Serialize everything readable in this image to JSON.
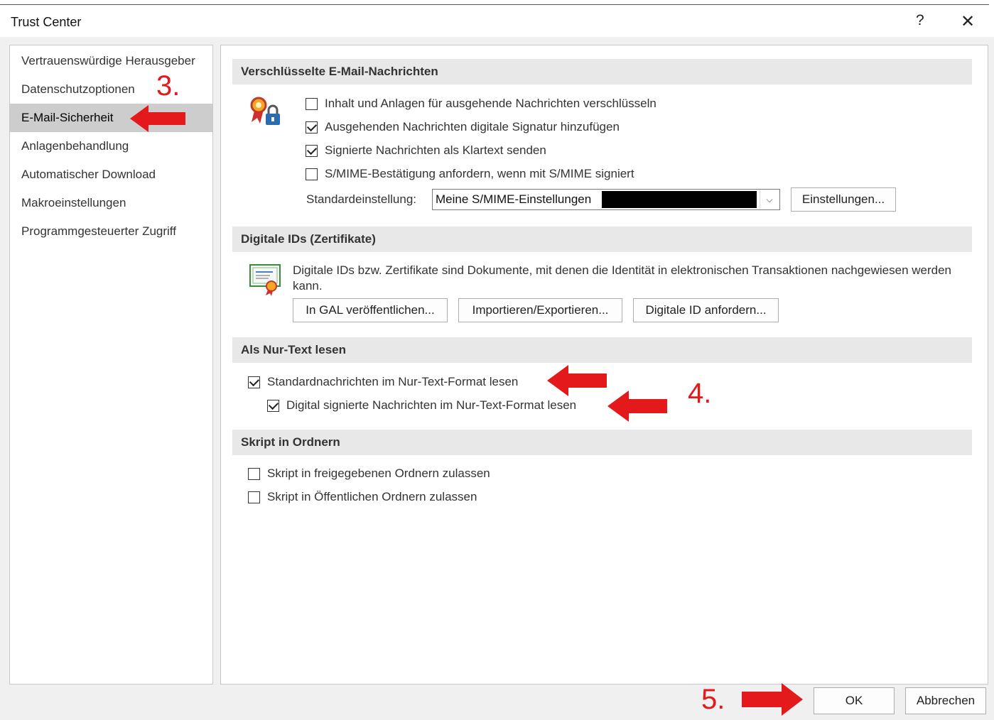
{
  "window": {
    "title": "Trust Center",
    "help_label": "?",
    "close_label": "✕"
  },
  "sidebar": {
    "items": [
      {
        "label": "Vertrauenswürdige Herausgeber"
      },
      {
        "label": "Datenschutzoptionen"
      },
      {
        "label": "E-Mail-Sicherheit",
        "active": true
      },
      {
        "label": "Anlagenbehandlung"
      },
      {
        "label": "Automatischer Download"
      },
      {
        "label": "Makroeinstellungen"
      },
      {
        "label": "Programmgesteuerter Zugriff"
      }
    ]
  },
  "sections": {
    "encrypted": {
      "heading": "Verschlüsselte E-Mail-Nachrichten",
      "icon": "certificate-lock-icon",
      "options": [
        {
          "label": "Inhalt und Anlagen für ausgehende Nachrichten verschlüsseln",
          "checked": false
        },
        {
          "label": "Ausgehenden Nachrichten digitale Signatur hinzufügen",
          "checked": true
        },
        {
          "label": "Signierte Nachrichten als Klartext senden",
          "checked": true
        },
        {
          "label": "S/MIME-Bestätigung anfordern, wenn mit S/MIME signiert",
          "checked": false
        }
      ],
      "default_label": "Standardeinstellung:",
      "default_value": "Meine S/MIME-Einstellungen",
      "settings_button": "Einstellungen..."
    },
    "digital_ids": {
      "heading": "Digitale IDs (Zertifikate)",
      "icon": "certificate-document-icon",
      "description": "Digitale IDs bzw. Zertifikate sind Dokumente, mit denen die Identität in elektronischen Transaktionen nachgewiesen werden kann.",
      "buttons": [
        "In GAL veröffentlichen...",
        "Importieren/Exportieren...",
        "Digitale ID anfordern..."
      ]
    },
    "plain_text": {
      "heading": "Als Nur-Text lesen",
      "options": [
        {
          "label": "Standardnachrichten im Nur-Text-Format lesen",
          "checked": true
        },
        {
          "label": "Digital signierte Nachrichten im Nur-Text-Format lesen",
          "checked": true
        }
      ]
    },
    "script": {
      "heading": "Skript in Ordnern",
      "options": [
        {
          "label": "Skript in freigegebenen Ordnern zulassen",
          "checked": false
        },
        {
          "label": "Skript in Öffentlichen Ordnern zulassen",
          "checked": false
        }
      ]
    }
  },
  "footer": {
    "ok_label": "OK",
    "cancel_label": "Abbrechen"
  },
  "annotations": {
    "step3": "3.",
    "step4": "4.",
    "step5": "5.",
    "color": "#e3191c"
  }
}
